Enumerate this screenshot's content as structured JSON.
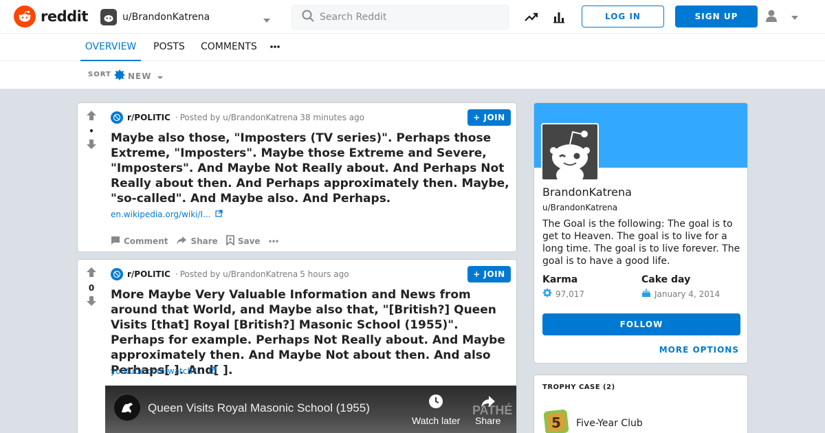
{
  "header": {
    "logo_text": "reddit",
    "username": "u/BrandonKatrena",
    "search_placeholder": "Search Reddit",
    "login_label": "LOG IN",
    "signup_label": "SIGN UP"
  },
  "tabs": [
    {
      "label": "OVERVIEW",
      "active": true
    },
    {
      "label": "POSTS",
      "active": false
    },
    {
      "label": "COMMENTS",
      "active": false
    }
  ],
  "sort": {
    "label": "SORT",
    "value": "NEW"
  },
  "posts": [
    {
      "score": "•",
      "subreddit": "r/POLITIC",
      "posted_by": "Posted by u/BrandonKatrena",
      "time": "38 minutes ago",
      "join_label": "JOIN",
      "title": "Maybe also those, \"Imposters (TV series)\". Perhaps those Extreme, \"Imposters\". Maybe those Extreme and Severe, \"Imposters\". And Maybe Not Really about. And Perhaps Not Really about then. And Perhaps approximately then. Maybe, \"so-called\". And Maybe also. And Perhaps.",
      "link": "en.wikipedia.org/wiki/I...",
      "actions": {
        "comment": "Comment",
        "share": "Share",
        "save": "Save"
      }
    },
    {
      "score": "0",
      "subreddit": "r/POLITIC",
      "posted_by": "Posted by u/BrandonKatrena",
      "time": "5 hours ago",
      "join_label": "JOIN",
      "title": "More Maybe Very Valuable Information and News from around that World, and Maybe also that, \"[British?] Queen Visits [that] Royal [British?] Masonic School (1955)\". Perhaps for example. Perhaps Not Really about. And Maybe approximately then. And Maybe Not about then. And also Perhaps[ ]. And[ ].",
      "link": "youtube.com/watch?...",
      "video": {
        "title": "Queen Visits Royal Masonic School (1955)",
        "watch_later": "Watch later",
        "share": "Share",
        "brand": "PATHÉ"
      }
    }
  ],
  "profile": {
    "name": "BrandonKatrena",
    "handle": "u/BrandonKatrena",
    "description": "The Goal is the following: The goal is to get to Heaven. The goal is to live for a long time. The goal is to live forever. The goal is to have a good life.",
    "karma_label": "Karma",
    "karma_value": "97,017",
    "cake_label": "Cake day",
    "cake_value": "January 4, 2014",
    "follow_label": "FOLLOW",
    "more_options": "MORE OPTIONS"
  },
  "trophy": {
    "header": "TROPHY CASE (2)",
    "items": [
      {
        "name": "Five-Year Club"
      }
    ]
  },
  "colors": {
    "accent": "#0079d3",
    "banner": "#33a8ff",
    "brand": "#ff4500"
  }
}
